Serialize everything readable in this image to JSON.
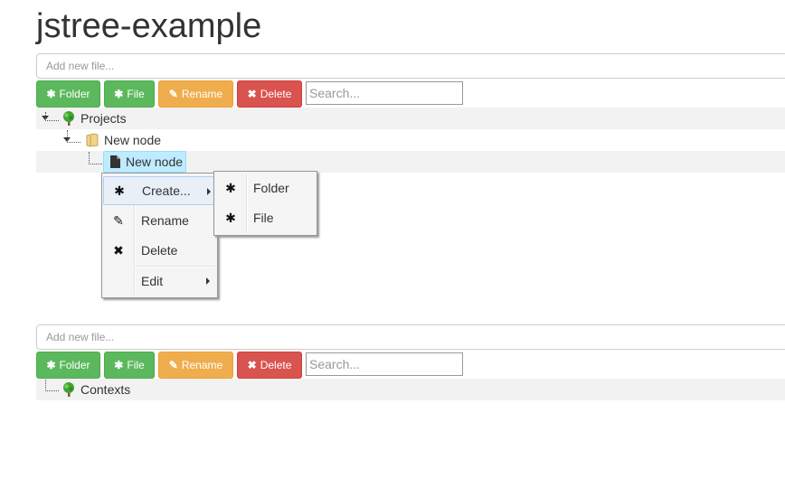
{
  "page": {
    "title": "jstree-example"
  },
  "panels": [
    {
      "file_input": {
        "placeholder": "Add new file..."
      },
      "toolbar": {
        "folder_label": "Folder",
        "file_label": "File",
        "rename_label": "Rename",
        "delete_label": "Delete",
        "search_placeholder": "Search..."
      },
      "tree": [
        {
          "label": "Projects",
          "icon": "tree-icon"
        },
        {
          "label": "New node",
          "icon": "folder-icon"
        },
        {
          "label": "New node",
          "icon": "file-icon",
          "selected": true
        }
      ]
    },
    {
      "file_input": {
        "placeholder": "Add new file..."
      },
      "toolbar": {
        "folder_label": "Folder",
        "file_label": "File",
        "rename_label": "Rename",
        "delete_label": "Delete",
        "search_placeholder": "Search..."
      },
      "tree": [
        {
          "label": "Contexts",
          "icon": "tree-icon"
        }
      ]
    }
  ],
  "context_menu": {
    "items": [
      {
        "label": "Create...",
        "icon": "asterisk-icon",
        "has_submenu": true
      },
      {
        "label": "Rename",
        "icon": "pencil-icon"
      },
      {
        "label": "Delete",
        "icon": "x-icon"
      },
      {
        "label": "Edit",
        "icon": "",
        "has_submenu": true
      }
    ],
    "submenu": [
      {
        "label": "Folder",
        "icon": "asterisk-icon"
      },
      {
        "label": "File",
        "icon": "asterisk-icon"
      }
    ]
  },
  "colors": {
    "success": "#5cb85c",
    "warning": "#f0ad4e",
    "danger": "#d9534f",
    "selected_node": "#beebff"
  }
}
